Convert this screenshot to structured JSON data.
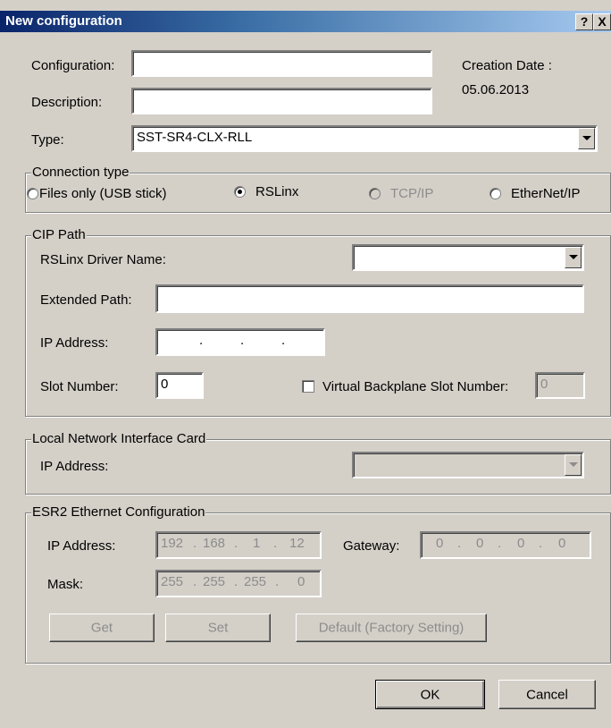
{
  "window": {
    "title": "New configuration",
    "help_label": "?",
    "close_label": "X"
  },
  "configuration": {
    "label": "Configuration:",
    "value": ""
  },
  "description": {
    "label": "Description:",
    "value": ""
  },
  "creation": {
    "label": "Creation Date :",
    "date": "05.06.2013"
  },
  "type": {
    "label": "Type:",
    "value": "SST-SR4-CLX-RLL"
  },
  "connection": {
    "title": "Connection type",
    "options": [
      {
        "label": "Files only (USB stick)",
        "checked": false,
        "enabled": true
      },
      {
        "label": "RSLinx",
        "checked": true,
        "enabled": true
      },
      {
        "label": "TCP/IP",
        "checked": false,
        "enabled": false
      },
      {
        "label": "EtherNet/IP",
        "checked": false,
        "enabled": true
      }
    ]
  },
  "cip": {
    "title": "CIP Path",
    "driver_label": "RSLinx Driver Name:",
    "driver_value": "",
    "extended_label": "Extended Path:",
    "extended_value": "",
    "ip_label": "IP Address:",
    "ip_dots": [
      ".",
      ".",
      "."
    ],
    "slot_label": "Slot Number:",
    "slot_value": "0",
    "virtual_label": "Virtual Backplane Slot Number:",
    "virtual_value": "0",
    "virtual_checked": false
  },
  "nic": {
    "title": "Local Network Interface Card",
    "ip_label": "IP Address:",
    "ip_value": ""
  },
  "esr2": {
    "title": "ESR2 Ethernet Configuration",
    "ip_label": "IP Address:",
    "ip": [
      "192",
      "168",
      "1",
      "12"
    ],
    "gateway_label": "Gateway:",
    "gateway": [
      "0",
      "0",
      "0",
      "0"
    ],
    "mask_label": "Mask:",
    "mask": [
      "255",
      "255",
      "255",
      "0"
    ],
    "get_label": "Get",
    "set_label": "Set",
    "default_label": "Default (Factory Setting)"
  },
  "footer": {
    "ok_label": "OK",
    "cancel_label": "Cancel"
  }
}
